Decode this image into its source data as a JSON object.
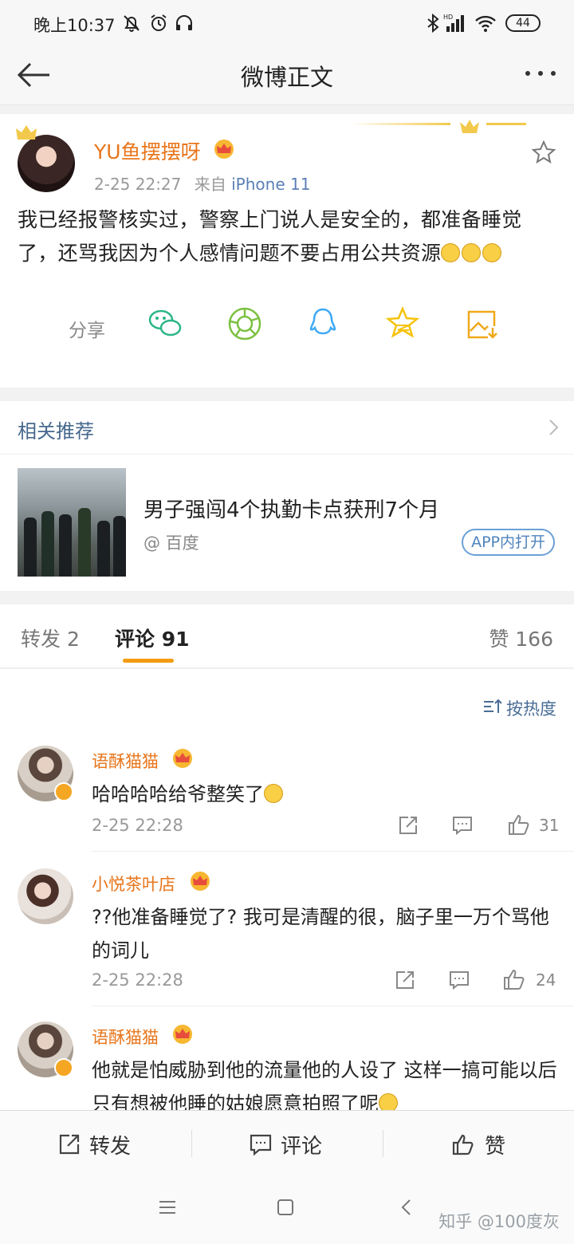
{
  "status_bar": {
    "time": "晚上10:37",
    "battery": "44"
  },
  "nav": {
    "title": "微博正文"
  },
  "post": {
    "username": "YU鱼摆摆呀",
    "date": "2-25 22:27",
    "source_prefix": "来自",
    "source": "iPhone 11",
    "text": "我已经报警核实过，警察上门说人是安全的，都准备睡觉了，还骂我因为个人感情问题不要占用公共资源",
    "share_label": "分享",
    "share_targets": [
      "wechat-icon",
      "moments-icon",
      "qq-icon",
      "qzone-icon",
      "save-image-icon"
    ],
    "colors": {
      "username": "#e8751a",
      "source": "#5b7fb5"
    }
  },
  "related": {
    "header": "相关推荐",
    "title": "男子强闯4个执勤卡点获刑7个月",
    "source": "@ 百度",
    "open_button": "APP内打开"
  },
  "tabs": {
    "repost": "转发 2",
    "comments": "评论 91",
    "likes": "赞 166",
    "accent": "#f39c12"
  },
  "comments": {
    "sort_label": "按热度",
    "items": [
      {
        "name": "语酥猫猫",
        "text": "哈哈哈哈给爷整笑了",
        "time": "2-25 22:28",
        "likes": "31"
      },
      {
        "name": "小悦茶叶店",
        "text": "??他准备睡觉了? 我可是清醒的很，脑子里一万个骂他的词儿",
        "time": "2-25 22:28",
        "likes": "24"
      },
      {
        "name": "语酥猫猫",
        "text": "他就是怕威胁到他的流量他的人设了 这样一搞可能以后只有想被他睡的姑娘愿意拍照了呢",
        "time": "",
        "likes": ""
      }
    ]
  },
  "action_bar": {
    "repost": "转发",
    "comment": "评论",
    "like": "赞"
  },
  "watermark": "知乎 @100度灰"
}
